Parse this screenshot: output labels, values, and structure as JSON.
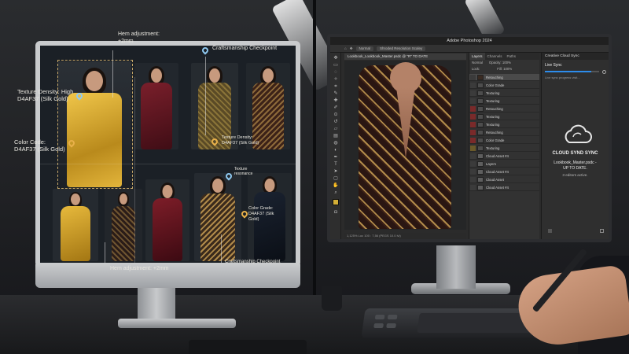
{
  "left_screen": {
    "annotations": {
      "hem_top": "Hem adjustment:\n+2mm",
      "craftsmanship_top": "Craftsmanship Checkpoint",
      "texture_density": "Texture Density: High\nD4AF37 (Silk Gold)",
      "color_code": "Color Code:\nD4AF37 (Silk Gold)",
      "texture_density_mid": "Texture Density:\nD4AF37 (Silk Gold)",
      "texture_resonance": "Texture\nresonance",
      "color_grade": "Color Grade:\nD4AF37 (Silk\nGold)",
      "hem_bottom": "Hem adjustment: +2mm",
      "craftsmanship_bottom": "Craftsmanship Checkpoint"
    }
  },
  "photoshop": {
    "app_title": "Adobe Photoshop 2024",
    "menu": {
      "mode": "Normal",
      "preset": "Shroded Resolution Scaley"
    },
    "document_tab": "Lookbook_Lookbook_Master.psdc @ \"R\" TO DATE",
    "status_text": "1,125%        Loc 100 : 7,56 (PEGS 10.0 lvl)",
    "layers_panel": {
      "tabs": [
        "Layers",
        "Channels",
        "Paths"
      ],
      "mode": "Normal",
      "opacity_label": "Opacity: 100%",
      "lock_label": "Lock:",
      "fill_label": "Fill: 100%",
      "layers": [
        "Retouching",
        "Color Grade",
        "Texturing",
        "Texturing",
        "Retouching",
        "Texturing",
        "Texturing",
        "Retouching",
        "Color Grade",
        "Texturing",
        "Cloud Asset #4",
        "Layers",
        "Cloud Asset #4",
        "Cloud Asset",
        "Cloud Asset #4"
      ]
    },
    "cloud_panel": {
      "title": "Creative Cloud Sync",
      "subtitle": "Live Sync",
      "progress": 0.85,
      "progress_text": "Live sync progress visit...",
      "status_title": "CLOUD SYND SYNC",
      "file_line": "Lookbook_Master.psdc -",
      "file_status": "UP TO DATE.",
      "editors_line": "3 editors active."
    },
    "accent": "#2d8ceb"
  },
  "colors": {
    "silk_gold": "#d4af37",
    "burgundy": "#5e1a22",
    "annotation_pin": "#e8b04a"
  }
}
